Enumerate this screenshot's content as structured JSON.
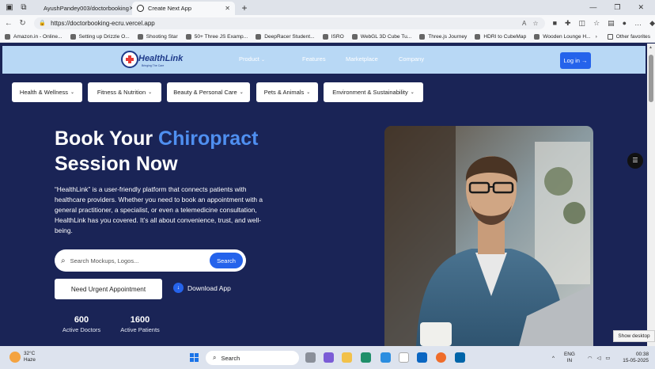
{
  "browser": {
    "tabs": [
      {
        "title": "AyushPandey003/doctorbooking",
        "active": false
      },
      {
        "title": "Create Next App",
        "active": true
      }
    ],
    "url": "https://doctorbooking-ecru.vercel.app",
    "bookmarks": [
      "Amazon.in - Online...",
      "Setting up Drizzle O...",
      "Shooting Star",
      "50+ Three JS Examp...",
      "DeepRacer Student...",
      "ISRO",
      "WebGL 3D Cube Tu...",
      "Three.js Journey",
      "HDRI to CubeMap",
      "Wooden Lounge H..."
    ],
    "other_favorites": "Other favorites"
  },
  "site": {
    "logo_name": "HealthLink",
    "logo_tagline": "Bringing The Care",
    "nav": [
      "Product",
      "Features",
      "Marketplace",
      "Company"
    ],
    "login": "Log in →",
    "categories": [
      "Health & Wellness",
      "Fitness & Nutrition",
      "Beauty & Personal Care",
      "Pets & Animals",
      "Environment & Sustainability"
    ],
    "hero": {
      "title_prefix": "Book Your ",
      "title_highlight": "Chiropract",
      "title_line2": "Session Now",
      "description": "“HealthLink” is a user-friendly platform that connects patients with healthcare providers. Whether you need to book an appointment with a general practitioner, a specialist, or even a telemedicine consultation, HealthLink has you covered. It’s all about convenience, trust, and well-being."
    },
    "search": {
      "placeholder": "Search Mockups, Logos...",
      "button": "Search"
    },
    "urgent_button": "Need Urgent Appointment",
    "download": "Download App",
    "stats": [
      {
        "number": "600",
        "label": "Active Doctors"
      },
      {
        "number": "1600",
        "label": "Active Patients"
      }
    ]
  },
  "tooltip": "Show desktop",
  "taskbar": {
    "weather_temp": "32°C",
    "weather_desc": "Haze",
    "search": "Search",
    "lang_1": "ENG",
    "lang_2": "IN",
    "time": "00:38",
    "date": "15-05-2025"
  },
  "colors": {
    "page_bg": "#1a2456",
    "header_bg": "#b8d8f5",
    "accent": "#2563eb",
    "highlight": "#4f8ff0"
  }
}
